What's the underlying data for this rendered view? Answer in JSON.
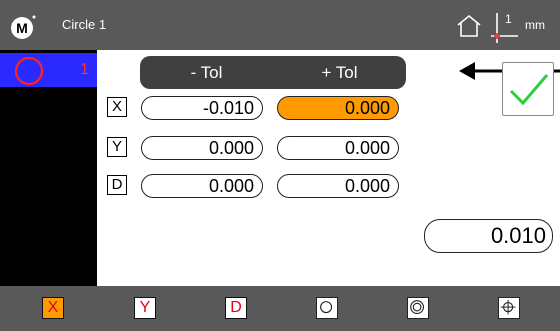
{
  "header": {
    "logo_letter": "M",
    "title": "Circle 1",
    "axis_number": "1",
    "unit": "mm"
  },
  "sidebar": {
    "feature": {
      "icon": "circle-icon",
      "number": "1"
    }
  },
  "tolerance": {
    "minus_label": "- Tol",
    "plus_label": "+ Tol",
    "rows": [
      {
        "label": "X",
        "minus": "-0.010",
        "plus": "0.000",
        "plus_active": true
      },
      {
        "label": "Y",
        "minus": "0.000",
        "plus": "0.000",
        "plus_active": false
      },
      {
        "label": "D",
        "minus": "0.000",
        "plus": "0.000",
        "plus_active": false
      }
    ]
  },
  "result_value": "0.010",
  "bottom_toolbar": {
    "x_label": "X",
    "y_label": "Y",
    "d_label": "D",
    "icons": [
      "circle-icon",
      "concentric-circle-icon",
      "crosshair-icon"
    ]
  },
  "colors": {
    "bar": "#595959",
    "sidebar": "#000000",
    "selected_feature": "#2a2aff",
    "active_field": "#ff9b00",
    "accent_red": "#e8001c",
    "check_green": "#2ecc40"
  }
}
